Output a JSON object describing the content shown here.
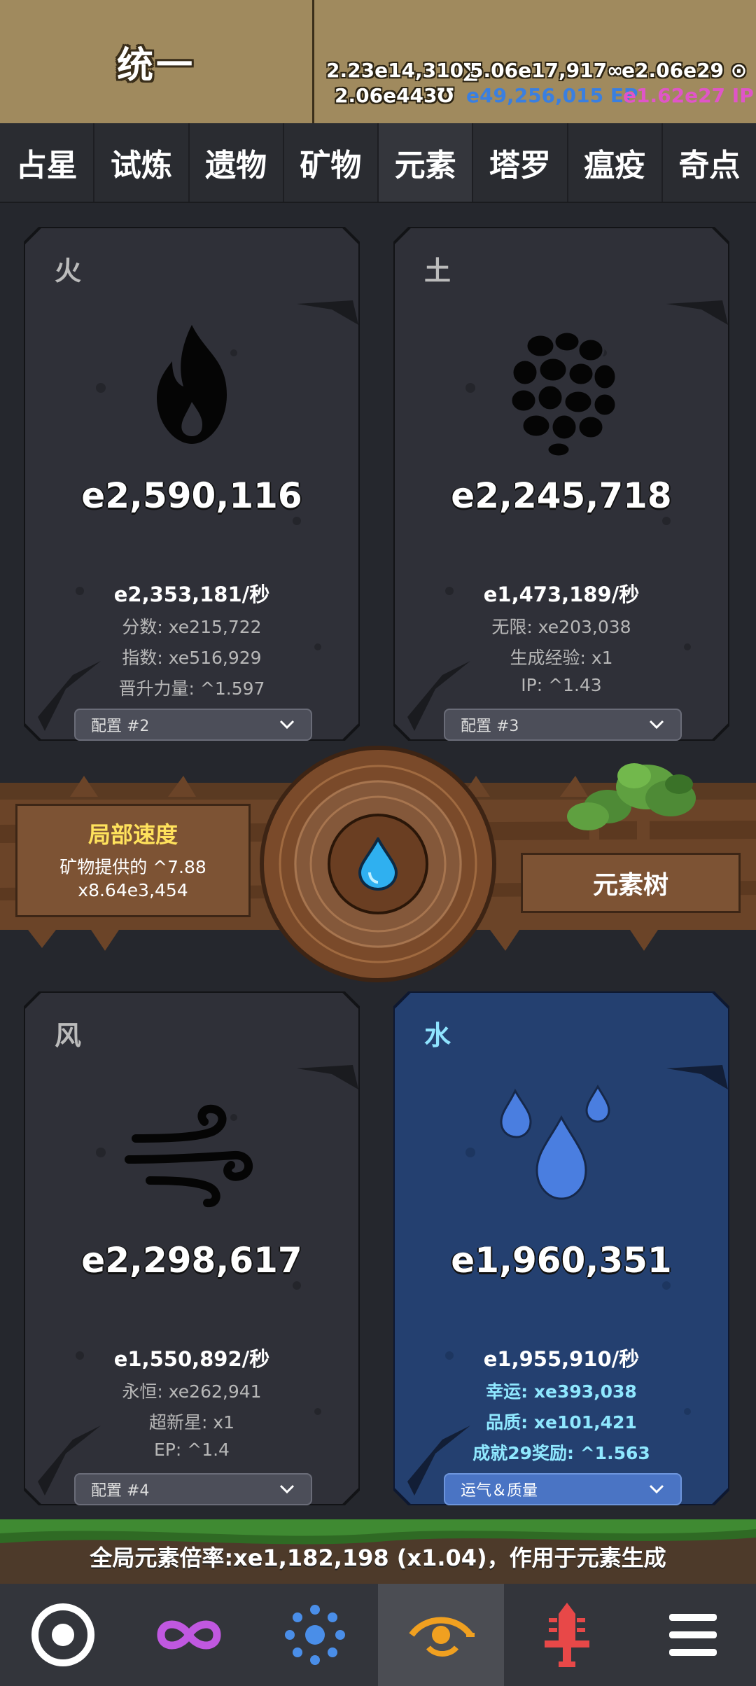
{
  "header": {
    "title": "统一",
    "stats": {
      "s1": "2.23e14,310∑",
      "s2": "5.06e17,917∞",
      "s3": "e2.06e29 ⊙",
      "s4": "2.06e443℧",
      "ep": "e49,256,015 EP",
      "ip": "e1.62e27 IP"
    }
  },
  "tabs": [
    "占星",
    "试炼",
    "遗物",
    "矿物",
    "元素",
    "塔罗",
    "瘟疫",
    "奇点"
  ],
  "active_tab": "元素",
  "elements": {
    "fire": {
      "name": "火",
      "amount": "e2,590,116",
      "rate": "e2,353,181/秒",
      "lines": [
        "分数: xe215,722",
        "指数: xe516,929",
        "晋升力量: ^1.597"
      ],
      "dropdown": "配置 #2",
      "icon": "fire-icon"
    },
    "earth": {
      "name": "土",
      "amount": "e2,245,718",
      "rate": "e1,473,189/秒",
      "lines": [
        "无限: xe203,038",
        "生成经验: x1",
        "IP: ^1.43"
      ],
      "dropdown": "配置 #3",
      "icon": "stones-icon"
    },
    "wind": {
      "name": "风",
      "amount": "e2,298,617",
      "rate": "e1,550,892/秒",
      "lines": [
        "永恒: xe262,941",
        "超新星: x1",
        "EP: ^1.4"
      ],
      "dropdown": "配置 #4",
      "icon": "wind-icon"
    },
    "water": {
      "name": "水",
      "amount": "e1,960,351",
      "rate": "e1,955,910/秒",
      "lines": [
        "幸运: xe393,038",
        "品质: xe101,421",
        "成就29奖励: ^1.563"
      ],
      "dropdown": "运气＆质量",
      "icon": "water-drops-icon"
    }
  },
  "local_speed": {
    "title": "局部速度",
    "source": "矿物提供的 ^7.88",
    "value": "x8.64e3,454"
  },
  "element_tree_button": "元素树",
  "global_multiplier": "全局元素倍率:xe1,182,198 (x1.04)，作用于元素生成",
  "navbar": [
    "target-icon",
    "infinity-icon",
    "dots-ring-icon",
    "eye-orbit-icon",
    "sword-icon",
    "menu-icon"
  ],
  "colors": {
    "header_bg": "#a08a5e",
    "card_bg": "#2f3038",
    "water_card_bg": "#244070",
    "speed_title": "#ffe25c",
    "ep_blue": "#3a7fe0",
    "ip_pink": "#e055c8"
  }
}
